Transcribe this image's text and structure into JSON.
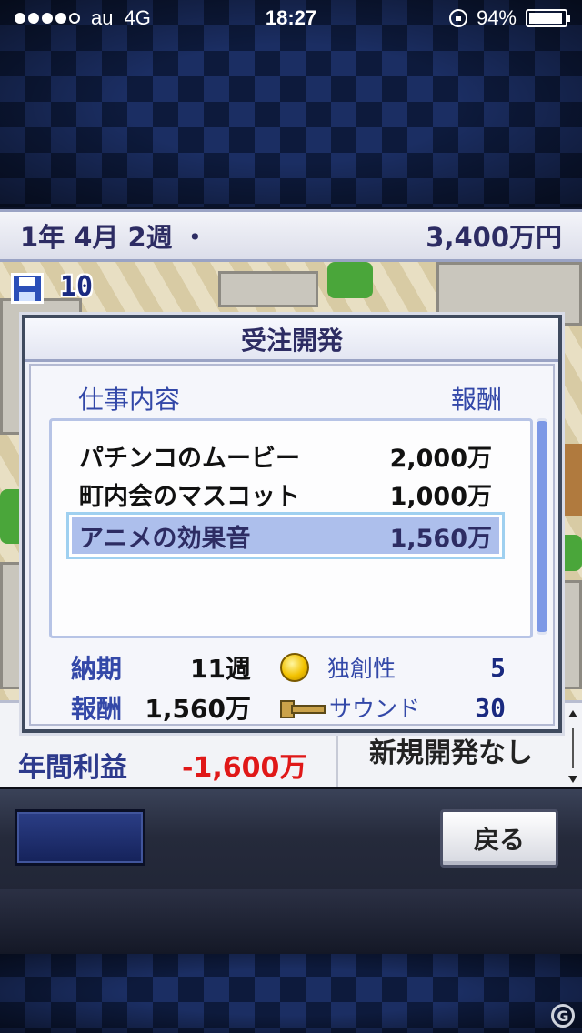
{
  "status_bar": {
    "carrier": "au",
    "network": "4G",
    "time": "18:27",
    "battery": "94%",
    "battery_level": 0.94
  },
  "header": {
    "date": "1年 4月 2週 ・",
    "funds": "3,400万円"
  },
  "save_count": "10",
  "dialog": {
    "title": "受注開発",
    "col_job": "仕事内容",
    "col_reward": "報酬",
    "jobs": [
      {
        "name": "パチンコのムービー",
        "reward": "2,000万",
        "selected": false
      },
      {
        "name": "町内会のマスコット",
        "reward": "1,000万",
        "selected": false
      },
      {
        "name": "アニメの効果音",
        "reward": "1,560万",
        "selected": true
      }
    ],
    "deadline_label": "納期",
    "deadline_value": "11週",
    "reward_label": "報酬",
    "reward_value": "1,560万",
    "stat1_name": "独創性",
    "stat1_value": "5",
    "stat1_icon": "coin-icon",
    "stat2_name": "サウンド",
    "stat2_value": "30",
    "stat2_icon": "trumpet-icon"
  },
  "lower_panel": {
    "annual_profit_label": "年間利益",
    "annual_profit_value": "-1,600万",
    "new_dev_status": "新規開発なし"
  },
  "toolbar": {
    "back_label": "戻る"
  },
  "colors": {
    "accent_blue": "#3348a8",
    "negative_red": "#e01818",
    "selection": "#adbfec"
  }
}
